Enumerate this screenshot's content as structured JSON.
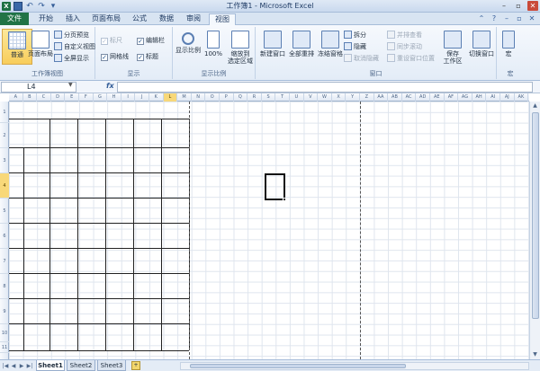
{
  "window": {
    "title": "工作簿1 - Microsoft Excel",
    "controls": [
      "–",
      "▫",
      "✕"
    ]
  },
  "tabs": [
    {
      "label": "文件"
    },
    {
      "label": "开始"
    },
    {
      "label": "插入"
    },
    {
      "label": "页面布局"
    },
    {
      "label": "公式"
    },
    {
      "label": "数据"
    },
    {
      "label": "审阅"
    },
    {
      "label": "视图"
    }
  ],
  "ribbon": {
    "workbook_views": {
      "label": "工作簿视图",
      "normal": "普通",
      "page_layout": "页面布局",
      "page_break_preview": "分页预览",
      "custom_views": "自定义视图",
      "full_screen": "全屏显示"
    },
    "show": {
      "label": "显示",
      "ruler": "标尺",
      "gridlines": "网格线",
      "formula_bar": "编辑栏",
      "headings": "标题"
    },
    "zoom": {
      "label": "显示比例",
      "zoom": "显示比例",
      "hundred": "100%",
      "zoom_to_selection_1": "缩放到",
      "zoom_to_selection_2": "选定区域"
    },
    "window": {
      "label": "窗口",
      "new_window": "新建窗口",
      "arrange_all": "全部重排",
      "freeze_panes": "冻结窗格",
      "split": "拆分",
      "hide": "隐藏",
      "unhide": "取消隐藏",
      "view_side_by_side": "并排查看",
      "sync_scroll": "同步滚动",
      "reset_position": "重设窗口位置",
      "save_workspace_1": "保存",
      "save_workspace_2": "工作区",
      "switch_windows": "切换窗口"
    },
    "macros": {
      "label": "宏",
      "macros": "宏"
    }
  },
  "formula_bar": {
    "name_box": "L4",
    "fx": "fx",
    "formula": ""
  },
  "columns": [
    "A",
    "B",
    "C",
    "D",
    "E",
    "F",
    "G",
    "H",
    "I",
    "J",
    "K",
    "L",
    "M",
    "N",
    "O",
    "P",
    "Q",
    "R",
    "S",
    "T",
    "U",
    "V",
    "W",
    "X",
    "Y",
    "Z",
    "AA",
    "AB",
    "AC",
    "AD",
    "AE",
    "AF",
    "AG",
    "AH",
    "AI",
    "AJ",
    "AK"
  ],
  "rows": [
    "1",
    "2",
    "3",
    "4",
    "5",
    "6",
    "7",
    "8",
    "9",
    "10",
    "11"
  ],
  "sheets": [
    {
      "label": "Sheet1"
    },
    {
      "label": "Sheet2"
    },
    {
      "label": "Sheet3"
    }
  ]
}
